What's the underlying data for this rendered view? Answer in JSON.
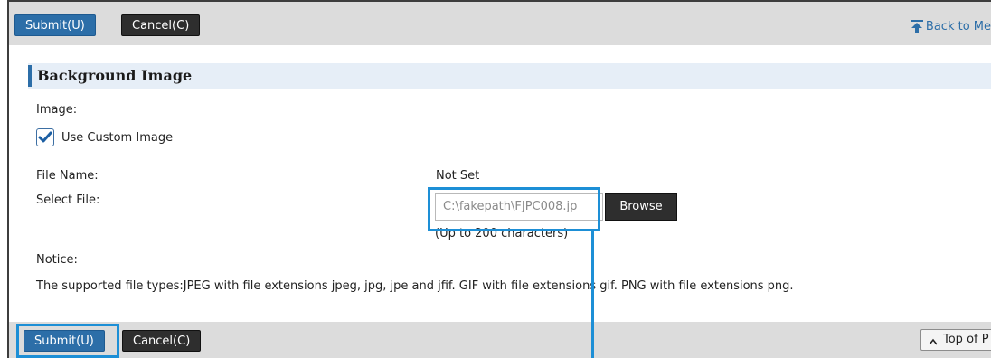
{
  "toolbar_top": {
    "submit_label": "Submit(U)",
    "cancel_label": "Cancel(C)",
    "back_link_label": "Back to Me"
  },
  "section": {
    "title": "Background Image"
  },
  "form": {
    "image_label": "Image:",
    "use_custom_image_label": "Use Custom Image",
    "use_custom_image_checked": true,
    "file_name_label": "File Name:",
    "file_name_value": "Not Set",
    "select_file_label": "Select File:",
    "select_file_value": "C:\\fakepath\\FJPC008.jp",
    "browse_label": "Browse",
    "char_limit_note": "(Up to 200 characters)",
    "notice_label": "Notice:",
    "notice_text": "The supported file types:JPEG with file extensions jpeg, jpg, jpe and jfif. GIF with file extensions gif. PNG with file extensions png."
  },
  "toolbar_bottom": {
    "submit_label": "Submit(U)",
    "cancel_label": "Cancel(C)",
    "top_of_page_label": "Top of P"
  },
  "colors": {
    "primary_button": "#2c6ea8",
    "dark_button": "#2e2e2e",
    "toolbar_bg": "#dcdcdc",
    "section_header_bg": "#e6eef7",
    "callout_highlight": "#1d8fd6"
  },
  "icons": {
    "back": "back-to-menu-icon",
    "top": "chevron-up-icon",
    "check": "checkmark-icon"
  }
}
